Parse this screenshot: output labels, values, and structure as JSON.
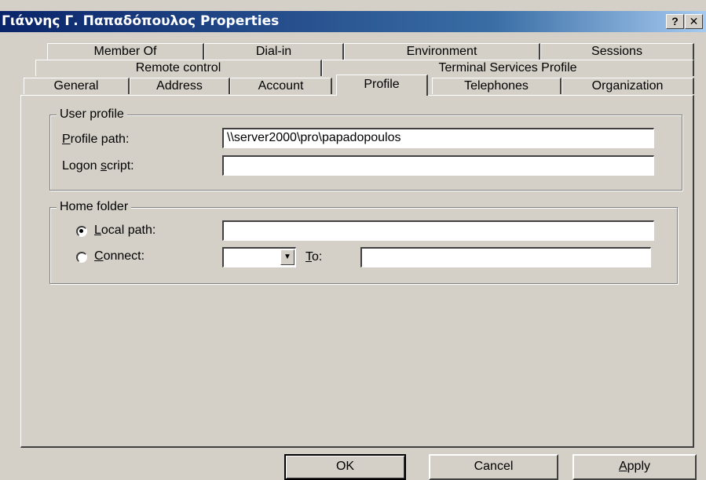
{
  "window": {
    "title": "Γιάννης Γ. Παπαδόπουλος Properties",
    "help_glyph": "?",
    "close_glyph": "✕"
  },
  "tabs": {
    "row1": [
      "Member Of",
      "Dial-in",
      "Environment",
      "Sessions"
    ],
    "row2": [
      "Remote control",
      "Terminal Services Profile"
    ],
    "row3": [
      "General",
      "Address",
      "Account",
      "Profile",
      "Telephones",
      "Organization"
    ],
    "active": "Profile"
  },
  "user_profile": {
    "legend": "User profile",
    "profile_path_label_key": "P",
    "profile_path_label_rest": "rofile path:",
    "profile_path_value": "\\\\server2000\\pro\\papadopoulos",
    "logon_script_label_pre": "Logon ",
    "logon_script_label_key": "s",
    "logon_script_label_rest": "cript:",
    "logon_script_value": ""
  },
  "home_folder": {
    "legend": "Home folder",
    "local_path_label_key": "L",
    "local_path_label_rest": "ocal path:",
    "local_path_value": "",
    "local_path_selected": true,
    "connect_label_key": "C",
    "connect_label_rest": "onnect:",
    "connect_drive_value": "",
    "to_label_key": "T",
    "to_label_rest": "o:",
    "to_value": ""
  },
  "buttons": {
    "ok": "OK",
    "cancel": "Cancel",
    "apply_key": "A",
    "apply_rest": "pply"
  },
  "icons": {
    "radio_selected": "radio-selected-icon",
    "radio_unselected": "radio-unselected-icon",
    "dropdown": "dropdown-arrow-icon"
  }
}
